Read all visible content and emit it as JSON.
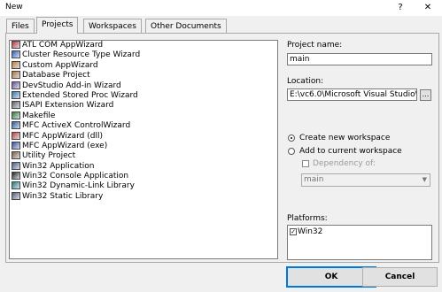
{
  "window": {
    "title": "New",
    "help_glyph": "?",
    "close_glyph": "✕"
  },
  "tabs": [
    {
      "label": "Files",
      "active": false
    },
    {
      "label": "Projects",
      "active": true
    },
    {
      "label": "Workspaces",
      "active": false
    },
    {
      "label": "Other Documents",
      "active": false
    }
  ],
  "project_types": [
    {
      "label": "ATL COM AppWizard",
      "icon": "atl-icon"
    },
    {
      "label": "Cluster Resource Type Wizard",
      "icon": "cluster-icon"
    },
    {
      "label": "Custom AppWizard",
      "icon": "custom-appwizard-icon"
    },
    {
      "label": "Database Project",
      "icon": "database-icon"
    },
    {
      "label": "DevStudio Add-in Wizard",
      "icon": "addin-icon"
    },
    {
      "label": "Extended Stored Proc Wizard",
      "icon": "stored-proc-icon"
    },
    {
      "label": "ISAPI Extension Wizard",
      "icon": "isapi-icon"
    },
    {
      "label": "Makefile",
      "icon": "makefile-icon"
    },
    {
      "label": "MFC ActiveX ControlWizard",
      "icon": "activex-icon"
    },
    {
      "label": "MFC AppWizard (dll)",
      "icon": "mfc-dll-icon"
    },
    {
      "label": "MFC AppWizard (exe)",
      "icon": "mfc-exe-icon"
    },
    {
      "label": "Utility Project",
      "icon": "utility-icon"
    },
    {
      "label": "Win32 Application",
      "icon": "win32-app-icon"
    },
    {
      "label": "Win32 Console Application",
      "icon": "console-icon"
    },
    {
      "label": "Win32 Dynamic-Link Library",
      "icon": "dll-icon"
    },
    {
      "label": "Win32 Static Library",
      "icon": "static-lib-icon"
    }
  ],
  "project_name": {
    "label": "Project name:",
    "value": "main"
  },
  "location": {
    "label": "Location:",
    "value": "E:\\vc6.0\\Microsoft Visual Studio\\",
    "browse_label": "..."
  },
  "workspace": {
    "create_label": "Create new workspace",
    "add_label": "Add to current workspace",
    "selected": "create",
    "dependency_label": "Dependency of:",
    "dependency_value": "main"
  },
  "platforms": {
    "label": "Platforms:",
    "items": [
      {
        "label": "Win32",
        "checked": true
      }
    ]
  },
  "buttons": {
    "ok": "OK",
    "cancel": "Cancel"
  }
}
